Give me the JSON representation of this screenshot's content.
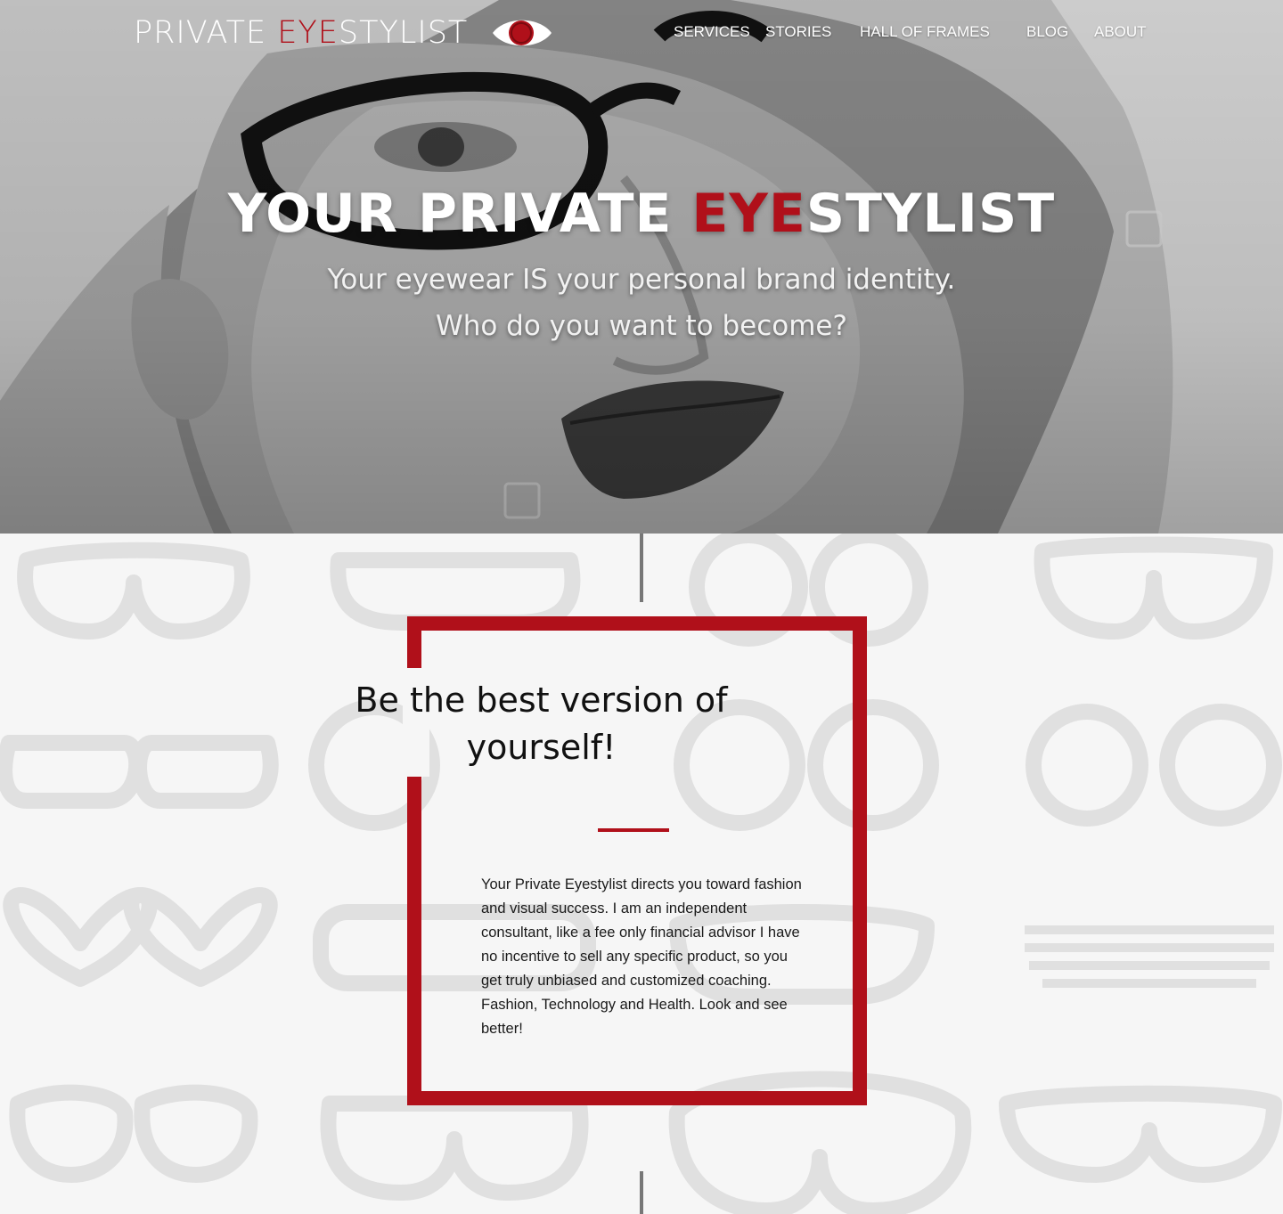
{
  "header": {
    "brand": {
      "part1": "PRIVATE ",
      "accent": "EYE",
      "part2": "STYLIST",
      "logo_icon": "eye-icon"
    },
    "nav": [
      {
        "label": "SERVICES"
      },
      {
        "label": "STORIES"
      },
      {
        "label": "HALL OF FRAMES"
      },
      {
        "label": "BLOG"
      },
      {
        "label": "ABOUT"
      }
    ]
  },
  "hero": {
    "title_part1": "YOUR PRIVATE ",
    "title_accent": "EYE",
    "title_part2": "STYLIST",
    "subtitle_line1": "Your eyewear IS your personal brand identity.",
    "subtitle_line2": "Who do you want to become?"
  },
  "intro": {
    "heading": "Be the best version of yourself!",
    "body": "Your Private Eyestylist directs you toward fashion and visual success. I am an independent consultant, like a fee only financial advisor I have no incentive to sell any specific product, so you get truly unbiased and customized coaching.  Fashion, Technology and Health. Look and see better!"
  },
  "colors": {
    "accent_red": "#b0101a",
    "pattern_gray": "#e0e0e0",
    "background": "#f6f6f6"
  }
}
